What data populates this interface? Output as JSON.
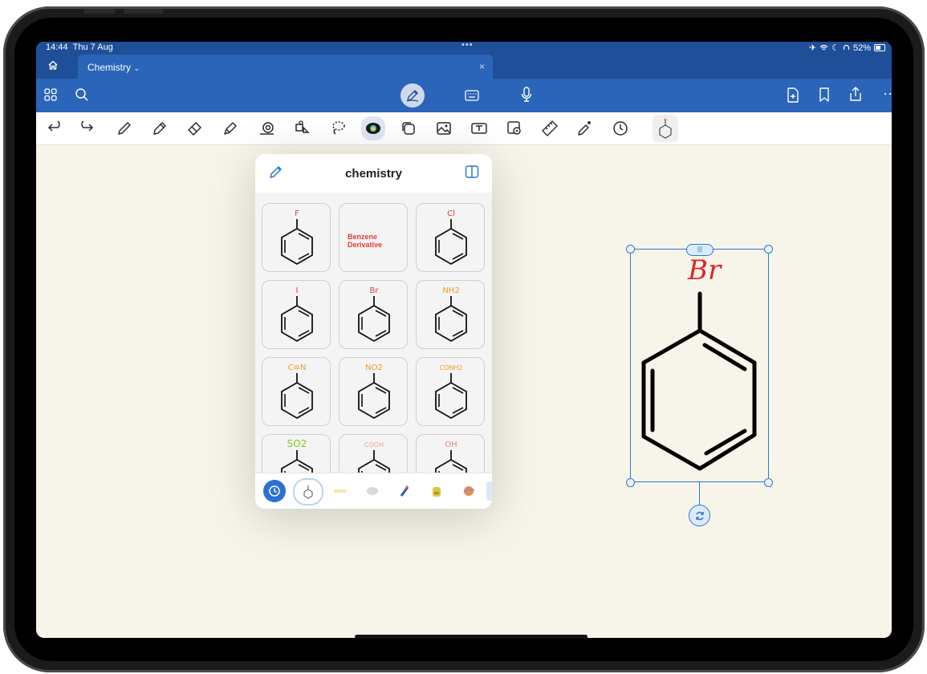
{
  "status": {
    "time": "14:44",
    "date": "Thu 7 Aug",
    "battery": "52%",
    "dots": "•••"
  },
  "tabs": {
    "home_icon": "home-icon",
    "active_title": "Chemistry",
    "chevron": "⌄",
    "close": "×"
  },
  "navbar": {
    "icons": [
      "grid-icon",
      "search-icon",
      "pen-mode-icon",
      "keyboard-icon",
      "microphone-icon",
      "new-page-icon",
      "bookmark-icon",
      "share-icon",
      "more-icon"
    ]
  },
  "toolbar": {
    "tools": [
      "undo",
      "redo",
      "pen",
      "pencil",
      "eraser",
      "highlighter",
      "shape",
      "lasso-shapes",
      "lasso",
      "elements",
      "sticky",
      "image",
      "text",
      "camera",
      "ruler",
      "laser",
      "timer",
      "custom-element"
    ]
  },
  "panel": {
    "title": "chemistry",
    "tiles": [
      {
        "label": "F",
        "color": "#e33b3b"
      },
      {
        "label": "Benzene\nDerivative",
        "color": "#e33b3b"
      },
      {
        "label": "Cl",
        "color": "#e33b3b"
      },
      {
        "label": "I",
        "color": "#e33b3b"
      },
      {
        "label": "Br",
        "color": "#e33b3b"
      },
      {
        "label": "NH2",
        "color": "#f29b2c"
      },
      {
        "label": "C≡N",
        "color": "#f29b2c"
      },
      {
        "label": "NO2",
        "color": "#f29b2c"
      },
      {
        "label": "CONH2",
        "color": "#f29b2c"
      },
      {
        "label": "SO2",
        "color": "#7cc52a"
      },
      {
        "label": "COOH",
        "color": "#f0a0a0"
      },
      {
        "label": "OH",
        "color": "#e88080"
      }
    ],
    "benzene_text_line1": "Benzene",
    "benzene_text_line2": "Derivative",
    "bottom_items": [
      "recent-clock-icon",
      "benzene-collection-icon",
      "tape-icon",
      "cloud-icon",
      "pen-sticker-icon",
      "backpack-icon",
      "planet-icon"
    ]
  },
  "canvas": {
    "selected_label": "Br",
    "label_color": "#e02525"
  },
  "colors": {
    "accent": "#2c78d0",
    "header": "#2b65b9",
    "paper": "#f7f5e9"
  }
}
